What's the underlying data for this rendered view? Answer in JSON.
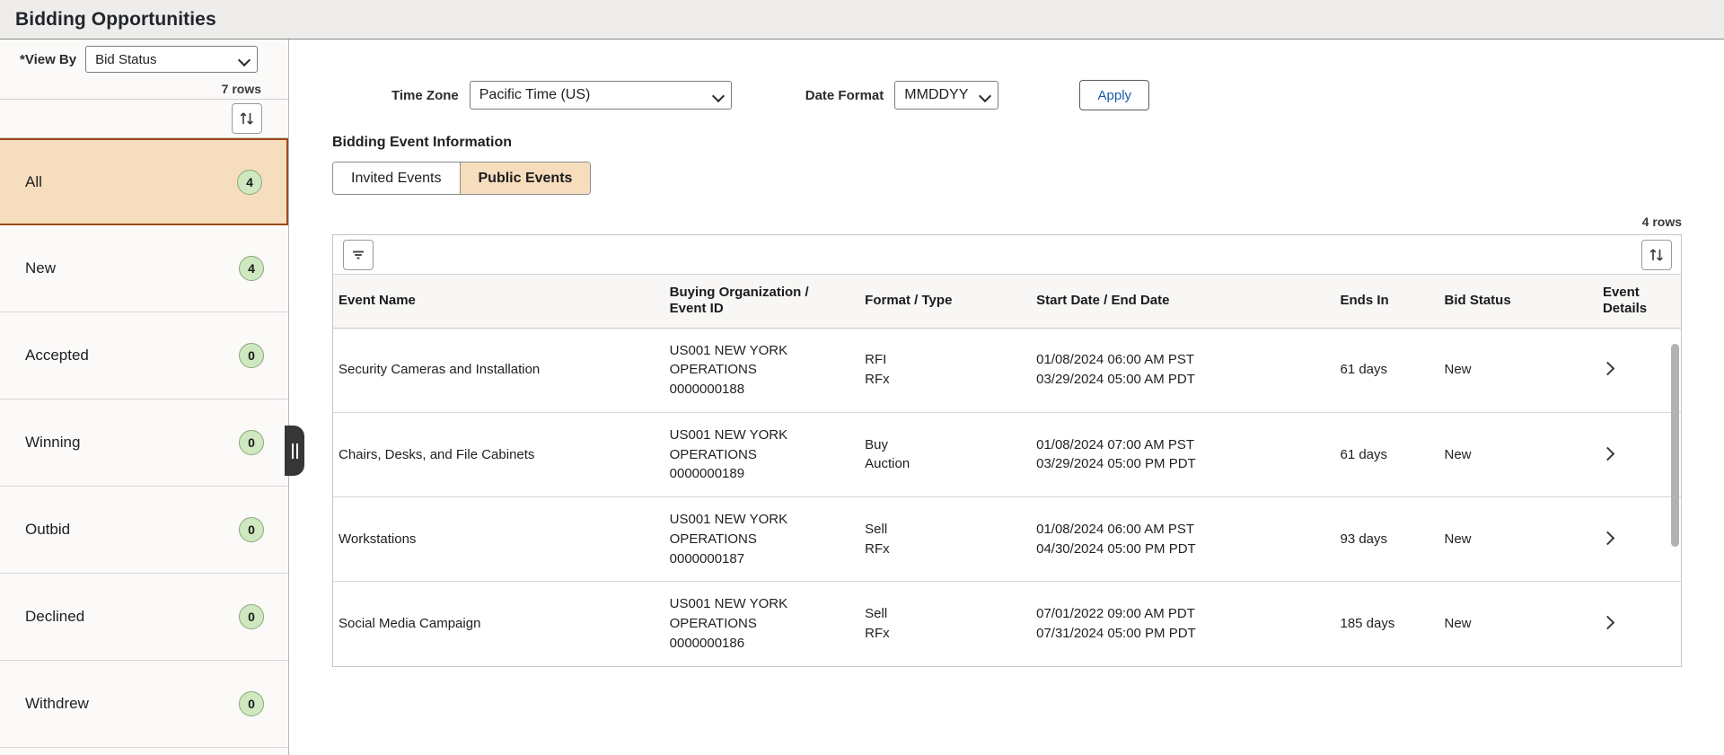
{
  "header": {
    "title": "Bidding Opportunities"
  },
  "sidebar": {
    "view_by_label": "*View By",
    "view_by_value": "Bid Status",
    "rows_count": "7 rows",
    "sort_icon": "sort-icon",
    "items": [
      {
        "label": "All",
        "count": "4",
        "active": true
      },
      {
        "label": "New",
        "count": "4",
        "active": false
      },
      {
        "label": "Accepted",
        "count": "0",
        "active": false
      },
      {
        "label": "Winning",
        "count": "0",
        "active": false
      },
      {
        "label": "Outbid",
        "count": "0",
        "active": false
      },
      {
        "label": "Declined",
        "count": "0",
        "active": false
      },
      {
        "label": "Withdrew",
        "count": "0",
        "active": false
      }
    ]
  },
  "toolbar": {
    "time_zone_label": "Time Zone",
    "time_zone_value": "Pacific Time (US)",
    "date_format_label": "Date Format",
    "date_format_value": "MMDDYY",
    "apply_label": "Apply"
  },
  "main": {
    "section_title": "Bidding Event Information",
    "tabs": [
      {
        "label": "Invited Events",
        "active": false
      },
      {
        "label": "Public Events",
        "active": true
      }
    ],
    "rows_count": "4 rows",
    "filter_icon": "filter-icon",
    "sort_icon": "sort-icon",
    "columns": {
      "event_name": "Event Name",
      "buying_org": "Buying Organization / Event ID",
      "buying_org_line1": "Buying Organization /",
      "buying_org_line2": "Event ID",
      "format_type": "Format / Type",
      "start_end": "Start Date / End Date",
      "ends_in": "Ends In",
      "bid_status": "Bid Status",
      "event_details_line1": "Event",
      "event_details_line2": "Details"
    },
    "rows": [
      {
        "event_name": "Security Cameras and Installation",
        "org_name_line1": "US001 NEW YORK",
        "org_name_line2": "OPERATIONS",
        "event_id": "0000000188",
        "format": "RFI",
        "type": "RFx",
        "start_date": "01/08/2024 06:00 AM PST",
        "end_date": "03/29/2024 05:00 AM PDT",
        "ends_in": "61 days",
        "bid_status": "New",
        "details_icon": "chevron-right-icon"
      },
      {
        "event_name": "Chairs, Desks, and File Cabinets",
        "org_name_line1": "US001 NEW YORK",
        "org_name_line2": "OPERATIONS",
        "event_id": "0000000189",
        "format": "Buy",
        "type": "Auction",
        "start_date": "01/08/2024 07:00 AM PST",
        "end_date": "03/29/2024 05:00 PM PDT",
        "ends_in": "61 days",
        "bid_status": "New",
        "details_icon": "chevron-right-icon"
      },
      {
        "event_name": "Workstations",
        "org_name_line1": "US001 NEW YORK",
        "org_name_line2": "OPERATIONS",
        "event_id": "0000000187",
        "format": "Sell",
        "type": "RFx",
        "start_date": "01/08/2024 06:00 AM PST",
        "end_date": "04/30/2024 05:00 PM PDT",
        "ends_in": "93 days",
        "bid_status": "New",
        "details_icon": "chevron-right-icon"
      },
      {
        "event_name": "Social Media Campaign",
        "org_name_line1": "US001 NEW YORK",
        "org_name_line2": "OPERATIONS",
        "event_id": "0000000186",
        "format": "Sell",
        "type": "RFx",
        "start_date": "07/01/2022 09:00 AM PDT",
        "end_date": "07/31/2024 05:00 PM PDT",
        "ends_in": "185 days",
        "bid_status": "New",
        "details_icon": "chevron-right-icon"
      }
    ]
  },
  "colors": {
    "header_bg": "#eeedeb",
    "active_accent": "#f6ddbd",
    "active_border": "#9c4a1a",
    "badge_bg": "#cfe8c0",
    "link_blue": "#1a5aa8"
  }
}
